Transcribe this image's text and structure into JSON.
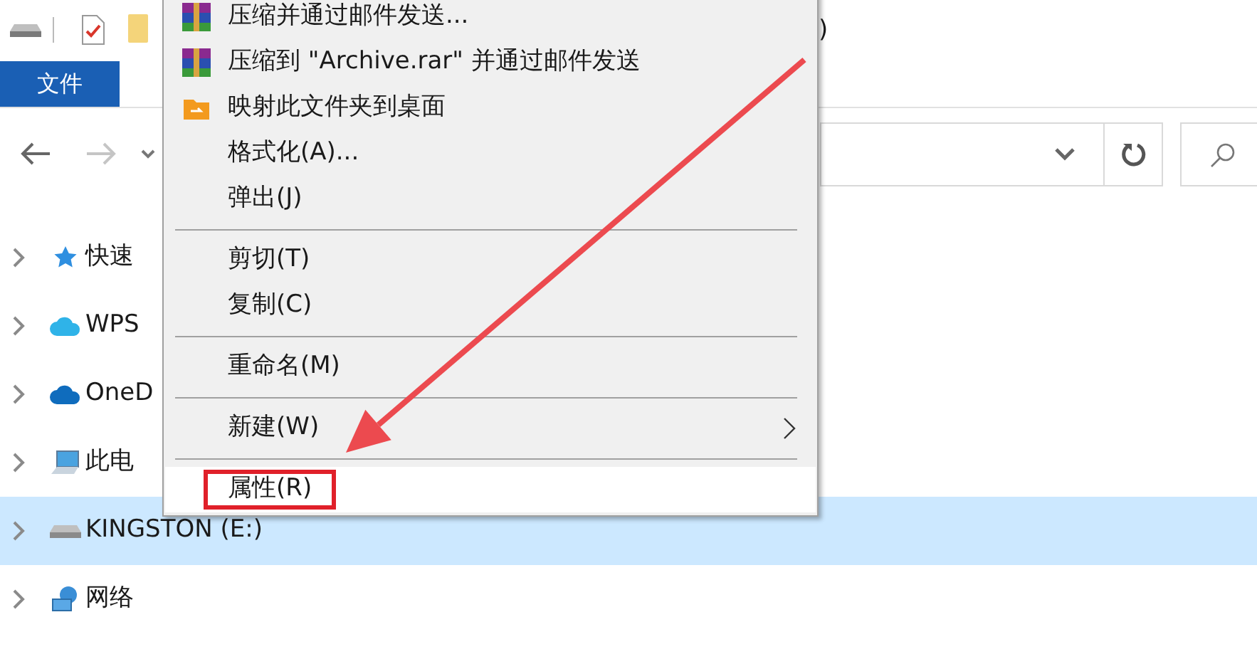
{
  "window": {
    "title_fragment": ")"
  },
  "ribbon": {
    "tabs": [
      {
        "label": "文件",
        "selected": true
      }
    ]
  },
  "navigation": {
    "items": [
      {
        "label": "快速",
        "selected": false
      },
      {
        "label": "WPS",
        "selected": false
      },
      {
        "label": "OneD",
        "selected": false
      },
      {
        "label": "此电",
        "selected": false
      },
      {
        "label": "KINGSTON (E:)",
        "selected": true
      },
      {
        "label": "网络",
        "selected": false
      }
    ]
  },
  "context_menu": {
    "items": [
      {
        "kind": "item",
        "label": "压缩并通过邮件发送..."
      },
      {
        "kind": "item",
        "label": "压缩到 \"Archive.rar\" 并通过邮件发送"
      },
      {
        "kind": "item",
        "label": "映射此文件夹到桌面"
      },
      {
        "kind": "item",
        "label": "格式化(A)..."
      },
      {
        "kind": "item",
        "label": "弹出(J)"
      },
      {
        "kind": "separator"
      },
      {
        "kind": "item",
        "label": "剪切(T)"
      },
      {
        "kind": "item",
        "label": "复制(C)"
      },
      {
        "kind": "separator"
      },
      {
        "kind": "item",
        "label": "重命名(M)"
      },
      {
        "kind": "separator"
      },
      {
        "kind": "item",
        "label": "新建(W)",
        "submenu": true
      },
      {
        "kind": "separator"
      },
      {
        "kind": "item",
        "label": "属性(R)",
        "hovered": true,
        "annotated": true
      }
    ]
  }
}
